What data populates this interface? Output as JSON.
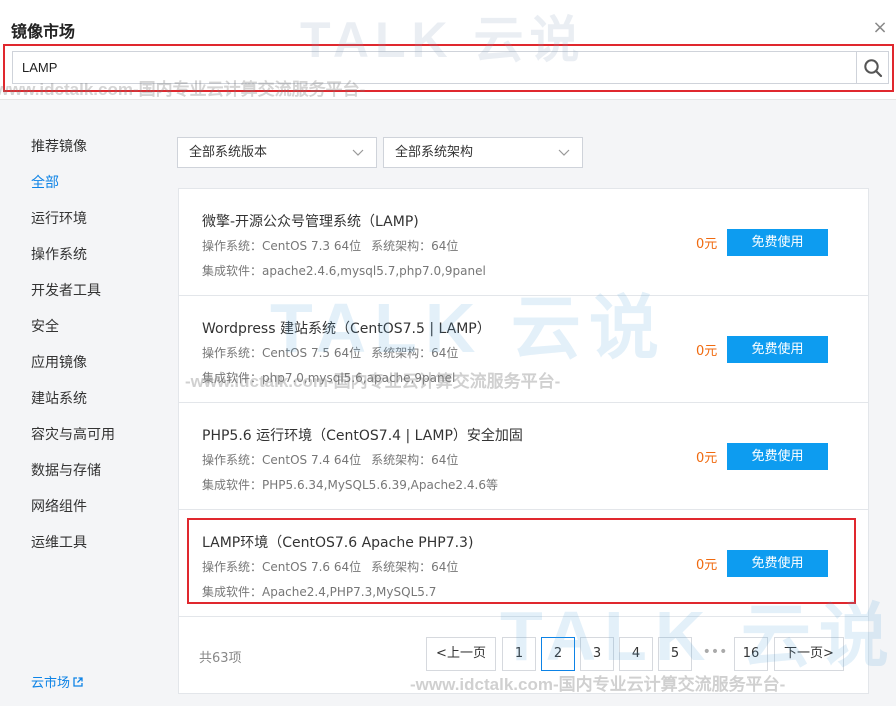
{
  "dialog": {
    "title": "镜像市场",
    "close_label": "×"
  },
  "search": {
    "value": "LAMP",
    "placeholder": ""
  },
  "sidebar": {
    "items": [
      {
        "label": "推荐镜像",
        "active": false
      },
      {
        "label": "全部",
        "active": true
      },
      {
        "label": "运行环境",
        "active": false
      },
      {
        "label": "操作系统",
        "active": false
      },
      {
        "label": "开发者工具",
        "active": false
      },
      {
        "label": "安全",
        "active": false
      },
      {
        "label": "应用镜像",
        "active": false
      },
      {
        "label": "建站系统",
        "active": false
      },
      {
        "label": "容灾与高可用",
        "active": false
      },
      {
        "label": "数据与存储",
        "active": false
      },
      {
        "label": "网络组件",
        "active": false
      },
      {
        "label": "运维工具",
        "active": false
      }
    ],
    "footer_link": "云市场"
  },
  "filters": {
    "version": "全部系统版本",
    "arch": "全部系统架构"
  },
  "images": [
    {
      "title": "微擎-开源公众号管理系统（LAMP)",
      "os": "操作系统：CentOS 7.3 64位",
      "arch": "系统架构：64位",
      "software": "集成软件：apache2.4.6,mysql5.7,php7.0,9panel",
      "price": "0元",
      "action": "免费使用"
    },
    {
      "title": "Wordpress 建站系统（CentOS7.5 | LAMP）",
      "os": "操作系统：CentOS 7.5 64位",
      "arch": "系统架构：64位",
      "software": "集成软件：php7.0,mysql5.6,apache,9panel",
      "price": "0元",
      "action": "免费使用"
    },
    {
      "title": "PHP5.6 运行环境（CentOS7.4 | LAMP）安全加固",
      "os": "操作系统：CentOS 7.4 64位",
      "arch": "系统架构：64位",
      "software": "集成软件：PHP5.6.34,MySQL5.6.39,Apache2.4.6等",
      "price": "0元",
      "action": "免费使用"
    },
    {
      "title": "LAMP环境（CentOS7.6 Apache PHP7.3)",
      "os": "操作系统：CentOS 7.6 64位",
      "arch": "系统架构：64位",
      "software": "集成软件：Apache2.4,PHP7.3,MySQL5.7",
      "price": "0元",
      "action": "免费使用"
    }
  ],
  "pagination": {
    "total": "共63项",
    "prev": "<上一页",
    "pages": [
      "1",
      "2",
      "3",
      "4",
      "5"
    ],
    "current": "2",
    "ellipsis": "•••",
    "last": "16",
    "next": "下一页>"
  },
  "watermark": {
    "brand": "TALK 云说",
    "url": "-www.idctalk.com-国内专业云计算交流服务平台-"
  },
  "colors": {
    "accent": "#0d83e6",
    "button": "#0d9cf0",
    "price": "#f06a0f",
    "highlight": "#e0282e"
  }
}
